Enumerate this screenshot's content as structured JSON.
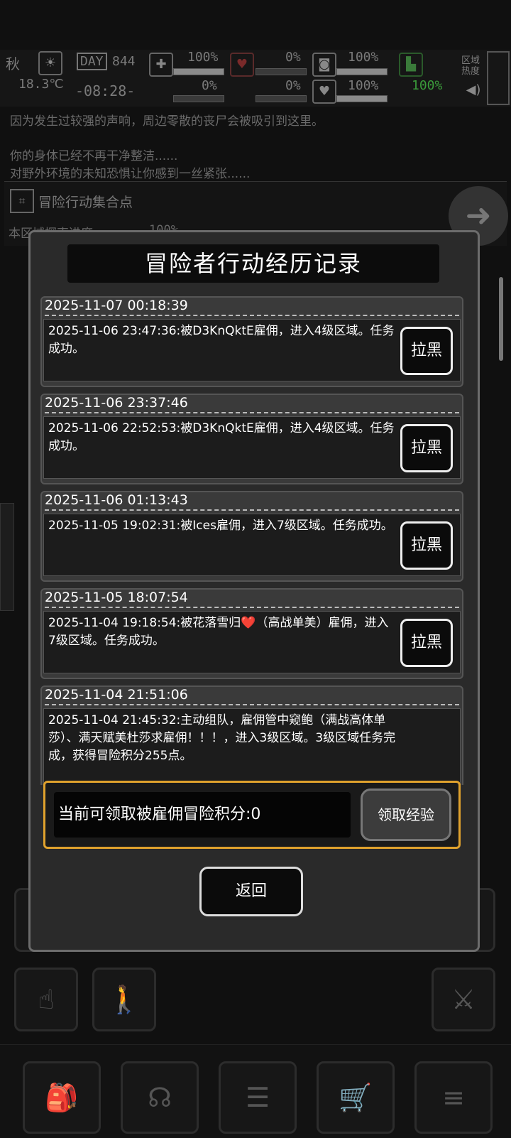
{
  "hud": {
    "season": "秋",
    "temperature": "18.3℃",
    "day_label": "DAY",
    "day_number": "844",
    "clock": "-08:28-",
    "stats": [
      {
        "label": "100%",
        "fill": 1.0
      },
      {
        "label": "0%",
        "fill": 0.0
      },
      {
        "label": "100%",
        "fill": 1.0
      },
      {
        "label": "0%",
        "fill": 0.0
      },
      {
        "label": "0%",
        "fill": 0.0
      },
      {
        "label": "100%",
        "fill": 1.0
      },
      {
        "label": "100%",
        "fill": 1.0
      }
    ],
    "area_heat_label": "区域热度"
  },
  "log": {
    "lines": [
      "因为发生过较强的声响，周边零散的丧尸会被吸引到这里。",
      "你的身体已经不再干净整洁......",
      "对野外环境的未知恐惧让你感到一丝紧张......"
    ]
  },
  "location": {
    "title": "冒险行动集合点",
    "progress_label": "本区域探索进度",
    "progress_value": "100%"
  },
  "dialog": {
    "title": "冒险者行动经历记录",
    "records": [
      {
        "time": "2025-11-07 00:18:39",
        "text": "2025-11-06 23:47:36:被D3KnQktE雇佣，进入4级区域。任务成功。",
        "button": "拉黑"
      },
      {
        "time": "2025-11-06 23:37:46",
        "text": "2025-11-06 22:52:53:被D3KnQktE雇佣，进入4级区域。任务成功。",
        "button": "拉黑"
      },
      {
        "time": "2025-11-06 01:13:43",
        "text": "2025-11-05 19:02:31:被Ices雇佣，进入7级区域。任务成功。",
        "button": "拉黑"
      },
      {
        "time": "2025-11-05 18:07:54",
        "text": "2025-11-04 19:18:54:被花落雪归❤️（高战单美）雇佣，进入7级区域。任务成功。",
        "button": "拉黑"
      },
      {
        "time": "2025-11-04 21:51:06",
        "text": "2025-11-04 21:45:32:主动组队，雇佣管中窥鲍（满战高体单莎）、满天赋美杜莎求雇佣！！！，进入3级区域。3级区域任务完成，获得冒险积分255点。",
        "button": ""
      }
    ],
    "claim_label": "当前可领取被雇佣冒险积分:0",
    "claim_button": "领取经验",
    "back_button": "返回"
  }
}
